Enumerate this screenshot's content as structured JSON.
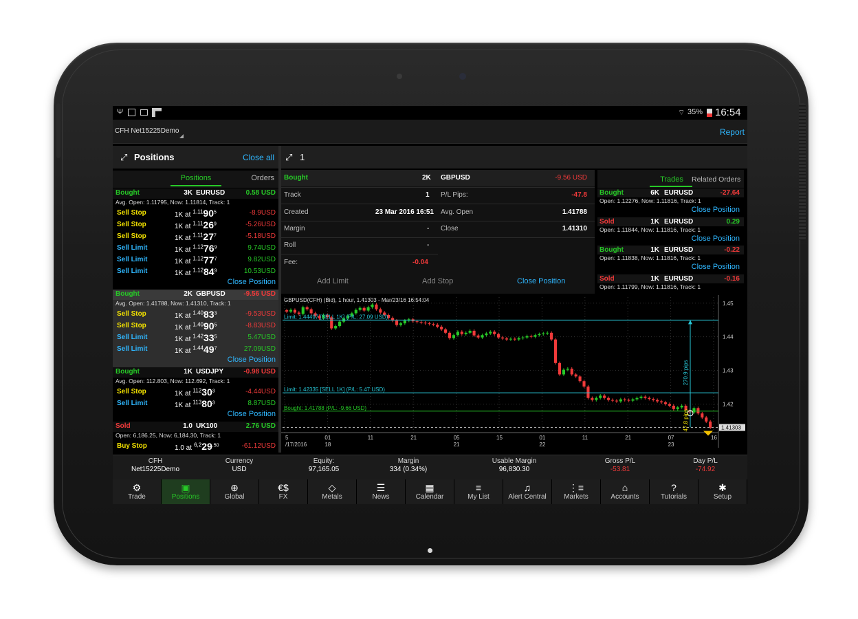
{
  "status": {
    "battery": "35%",
    "time": "16:54"
  },
  "appbar": {
    "account": "CFH Net15225Demo",
    "report": "Report"
  },
  "positions_panel": {
    "title": "Positions",
    "close_all": "Close all",
    "tabs": [
      "Positions",
      "Orders"
    ],
    "close_position": "Close Position",
    "groups": [
      {
        "side": "Bought",
        "qty": "3K",
        "symbol": "EURUSD",
        "pl": "0.58 USD",
        "info": "Avg. Open: 1.11795, Now: 1.11814, Track: 1",
        "orders": [
          {
            "type": "Sell Stop",
            "amt": "1K at",
            "p1": "1.11",
            "p2": "90",
            "p3": "5",
            "pl": "-8.9USD"
          },
          {
            "type": "Sell Stop",
            "amt": "1K at",
            "p1": "1.11",
            "p2": "26",
            "p3": "9",
            "pl": "-5.26USD"
          },
          {
            "type": "Sell Stop",
            "amt": "1K at",
            "p1": "1.11",
            "p2": "27",
            "p3": "7",
            "pl": "-5.18USD"
          },
          {
            "type": "Sell Limit",
            "amt": "1K at",
            "p1": "1.12",
            "p2": "76",
            "p3": "9",
            "pl": "9.74USD"
          },
          {
            "type": "Sell Limit",
            "amt": "1K at",
            "p1": "1.12",
            "p2": "77",
            "p3": "7",
            "pl": "9.82USD"
          },
          {
            "type": "Sell Limit",
            "amt": "1K at",
            "p1": "1.12",
            "p2": "84",
            "p3": "9",
            "pl": "10.53USD"
          }
        ]
      },
      {
        "side": "Bought",
        "qty": "2K",
        "symbol": "GBPUSD",
        "pl": "-9.56 USD",
        "info": "Avg. Open: 1.41788, Now: 1.41310, Track: 1",
        "orders": [
          {
            "type": "Sell Stop",
            "amt": "1K at",
            "p1": "1.40",
            "p2": "83",
            "p3": "3",
            "pl": "-9.53USD"
          },
          {
            "type": "Sell Stop",
            "amt": "1K at",
            "p1": "1.40",
            "p2": "90",
            "p3": "5",
            "pl": "-8.83USD"
          },
          {
            "type": "Sell Limit",
            "amt": "1K at",
            "p1": "1.42",
            "p2": "33",
            "p3": "5",
            "pl": "5.47USD"
          },
          {
            "type": "Sell Limit",
            "amt": "1K at",
            "p1": "1.44",
            "p2": "49",
            "p3": "7",
            "pl": "27.09USD"
          }
        ]
      },
      {
        "side": "Bought",
        "qty": "1K",
        "symbol": "USDJPY",
        "pl": "-0.98 USD",
        "info": "Avg. Open: 112.803, Now: 112.692, Track: 1",
        "orders": [
          {
            "type": "Sell Stop",
            "amt": "1K at",
            "p1": "112",
            "p2": "30",
            "p3": "3",
            "pl": "-4.44USD"
          },
          {
            "type": "Sell Limit",
            "amt": "1K at",
            "p1": "113",
            "p2": "80",
            "p3": "3",
            "pl": "8.87USD"
          }
        ]
      },
      {
        "side": "Sold",
        "qty": "1.0",
        "symbol": "UK100",
        "pl": "2.76 USD",
        "info": "Open: 6,186.25, Now: 6,184.30, Track: 1",
        "orders": [
          {
            "type": "Buy Stop",
            "amt": "1.0 at",
            "p1": "6,2",
            "p2": "29",
            "p3": ".50",
            "pl": "-61.12USD"
          },
          {
            "type": "Buy Limit",
            "amt": "1.0 at",
            "p1": "6,1",
            "p2": "36",
            "p3": ".98",
            "pl": "69.63USD"
          }
        ]
      }
    ]
  },
  "detail": {
    "title": "1",
    "side": "Bought",
    "qty": "2K",
    "symbol": "GBPUSD",
    "pl": "-9.56 USD",
    "track_label": "Track",
    "track": "1",
    "pips_label": "P/L Pips:",
    "pips": "-47.8",
    "created_label": "Created",
    "created": "23 Mar 2016 16:51",
    "avg_open_label": "Avg. Open",
    "avg_open": "1.41788",
    "margin_label": "Margin",
    "margin": "-",
    "close_label": "Close",
    "close": "1.41310",
    "roll_label": "Roll",
    "roll": "-",
    "fee_label": "Fee:",
    "fee": "-0.04",
    "add_limit": "Add Limit",
    "add_stop": "Add Stop",
    "close_position": "Close Position"
  },
  "trades_panel": {
    "tabs": [
      "Trades",
      "Related Orders"
    ],
    "close_position": "Close Position",
    "items": [
      {
        "side": "Bought",
        "qty": "6K",
        "symbol": "EURUSD",
        "pl": "-27.64",
        "info": "Open: 1.12276, Now: 1.11816, Track: 1"
      },
      {
        "side": "Sold",
        "qty": "1K",
        "symbol": "EURUSD",
        "pl": "0.29",
        "info": "Open: 1.11844, Now: 1.11816, Track: 1"
      },
      {
        "side": "Bought",
        "qty": "1K",
        "symbol": "EURUSD",
        "pl": "-0.22",
        "info": "Open: 1.11838, Now: 1.11816, Track: 1"
      },
      {
        "side": "Sold",
        "qty": "1K",
        "symbol": "EURUSD",
        "pl": "-0.16",
        "info": "Open: 1.11799, Now: 1.11816, Track: 1"
      }
    ]
  },
  "chart_data": {
    "type": "candlestick",
    "title": "GBPUSD(CFH) (Bid), 1 hour, 1.41303 - Mar/23/16 16:54:04",
    "y_ticks": [
      "1.45",
      "1.44",
      "1.43",
      "1.42"
    ],
    "ylim": [
      1.4115,
      1.4518
    ],
    "current_price": "1.41303",
    "lines": [
      {
        "label": "Limit: 1.44497 [SELL 1K] (P/L: 27.09 USD)",
        "value": 1.44497,
        "color": "#28c8d8"
      },
      {
        "label": "Limit: 1.42335 [SELL 1K] (P/L: 5.47 USD)",
        "value": 1.42335,
        "color": "#28c8d8"
      },
      {
        "label": "Bought: 1.41788 (P/L: -9.66 USD)",
        "value": 1.41788,
        "color": "#27c927"
      }
    ],
    "pips_up": "270.9 pips",
    "pips_down": "47.8 pips",
    "x_ticks_top": [
      "5",
      "01",
      "11",
      "21",
      "05",
      "15",
      "01",
      "11",
      "21",
      "07",
      "16"
    ],
    "x_ticks_bottom": [
      "/17/2016",
      "18",
      "",
      "",
      "21",
      "",
      "22",
      "",
      "",
      "23",
      ""
    ],
    "closes": [
      1.4475,
      1.448,
      1.4472,
      1.4468,
      1.4488,
      1.4482,
      1.447,
      1.4462,
      1.4455,
      1.4465,
      1.4458,
      1.4425,
      1.4432,
      1.4445,
      1.4455,
      1.4462,
      1.447,
      1.448,
      1.4486,
      1.4478,
      1.4488,
      1.4496,
      1.4482,
      1.4472,
      1.4465,
      1.4456,
      1.4448,
      1.4435,
      1.444,
      1.4448,
      1.4452,
      1.4446,
      1.4444,
      1.4442,
      1.444,
      1.4438,
      1.4436,
      1.443,
      1.4422,
      1.4412,
      1.4396,
      1.4405,
      1.4415,
      1.4408,
      1.4412,
      1.4418,
      1.4404,
      1.4398,
      1.4405,
      1.441,
      1.4415,
      1.4408,
      1.4398,
      1.4395,
      1.4392,
      1.4394,
      1.4392,
      1.4396,
      1.4398,
      1.4402,
      1.44,
      1.4405,
      1.4408,
      1.441,
      1.4412,
      1.4392,
      1.4322,
      1.4288,
      1.4302,
      1.4305,
      1.4288,
      1.4282,
      1.4268,
      1.4252,
      1.4218,
      1.4212,
      1.4218,
      1.4225,
      1.4218,
      1.4212,
      1.421,
      1.4208,
      1.4214,
      1.4212,
      1.421,
      1.4214,
      1.4218,
      1.4222,
      1.4218,
      1.4215,
      1.4212,
      1.4208,
      1.4205,
      1.42,
      1.4195,
      1.4185,
      1.419,
      1.4195,
      1.4182,
      1.4175,
      1.4188,
      1.4172,
      1.416,
      1.4148,
      1.413
    ]
  },
  "summary": [
    {
      "label": "CFH",
      "value": "Net15225Demo",
      "color": "#ffffff"
    },
    {
      "label": "Currency",
      "value": "USD",
      "color": "#ffffff"
    },
    {
      "label": "Equity:",
      "value": "97,165.05",
      "color": "#ffffff"
    },
    {
      "label": "Margin",
      "value": "334 (0.34%)",
      "color": "#ffffff"
    },
    {
      "label": "Usable Margin",
      "value": "96,830.30",
      "color": "#ffffff"
    },
    {
      "label": "Gross P/L",
      "value": "-53.81",
      "color": "#f03a3a"
    },
    {
      "label": "Day P/L",
      "value": "-74.92",
      "color": "#f03a3a"
    }
  ],
  "tabs": [
    {
      "label": "Trade",
      "icon": "trade-icon",
      "glyph": "⚙"
    },
    {
      "label": "Positions",
      "icon": "briefcase-icon",
      "glyph": "▣"
    },
    {
      "label": "Global",
      "icon": "globe-icon",
      "glyph": "⊕"
    },
    {
      "label": "FX",
      "icon": "currency-icon",
      "glyph": "€$"
    },
    {
      "label": "Metals",
      "icon": "metals-icon",
      "glyph": "◇"
    },
    {
      "label": "News",
      "icon": "news-icon",
      "glyph": "☰"
    },
    {
      "label": "Calendar",
      "icon": "calendar-icon",
      "glyph": "▦"
    },
    {
      "label": "My List",
      "icon": "list-icon",
      "glyph": "≡"
    },
    {
      "label": "Alert Central",
      "icon": "bell-icon",
      "glyph": "♫"
    },
    {
      "label": "Markets",
      "icon": "markets-icon",
      "glyph": "⋮≡"
    },
    {
      "label": "Accounts",
      "icon": "bank-icon",
      "glyph": "⌂"
    },
    {
      "label": "Tutorials",
      "icon": "tutorials-icon",
      "glyph": "?"
    },
    {
      "label": "Setup",
      "icon": "gear-icon",
      "glyph": "✱"
    }
  ]
}
